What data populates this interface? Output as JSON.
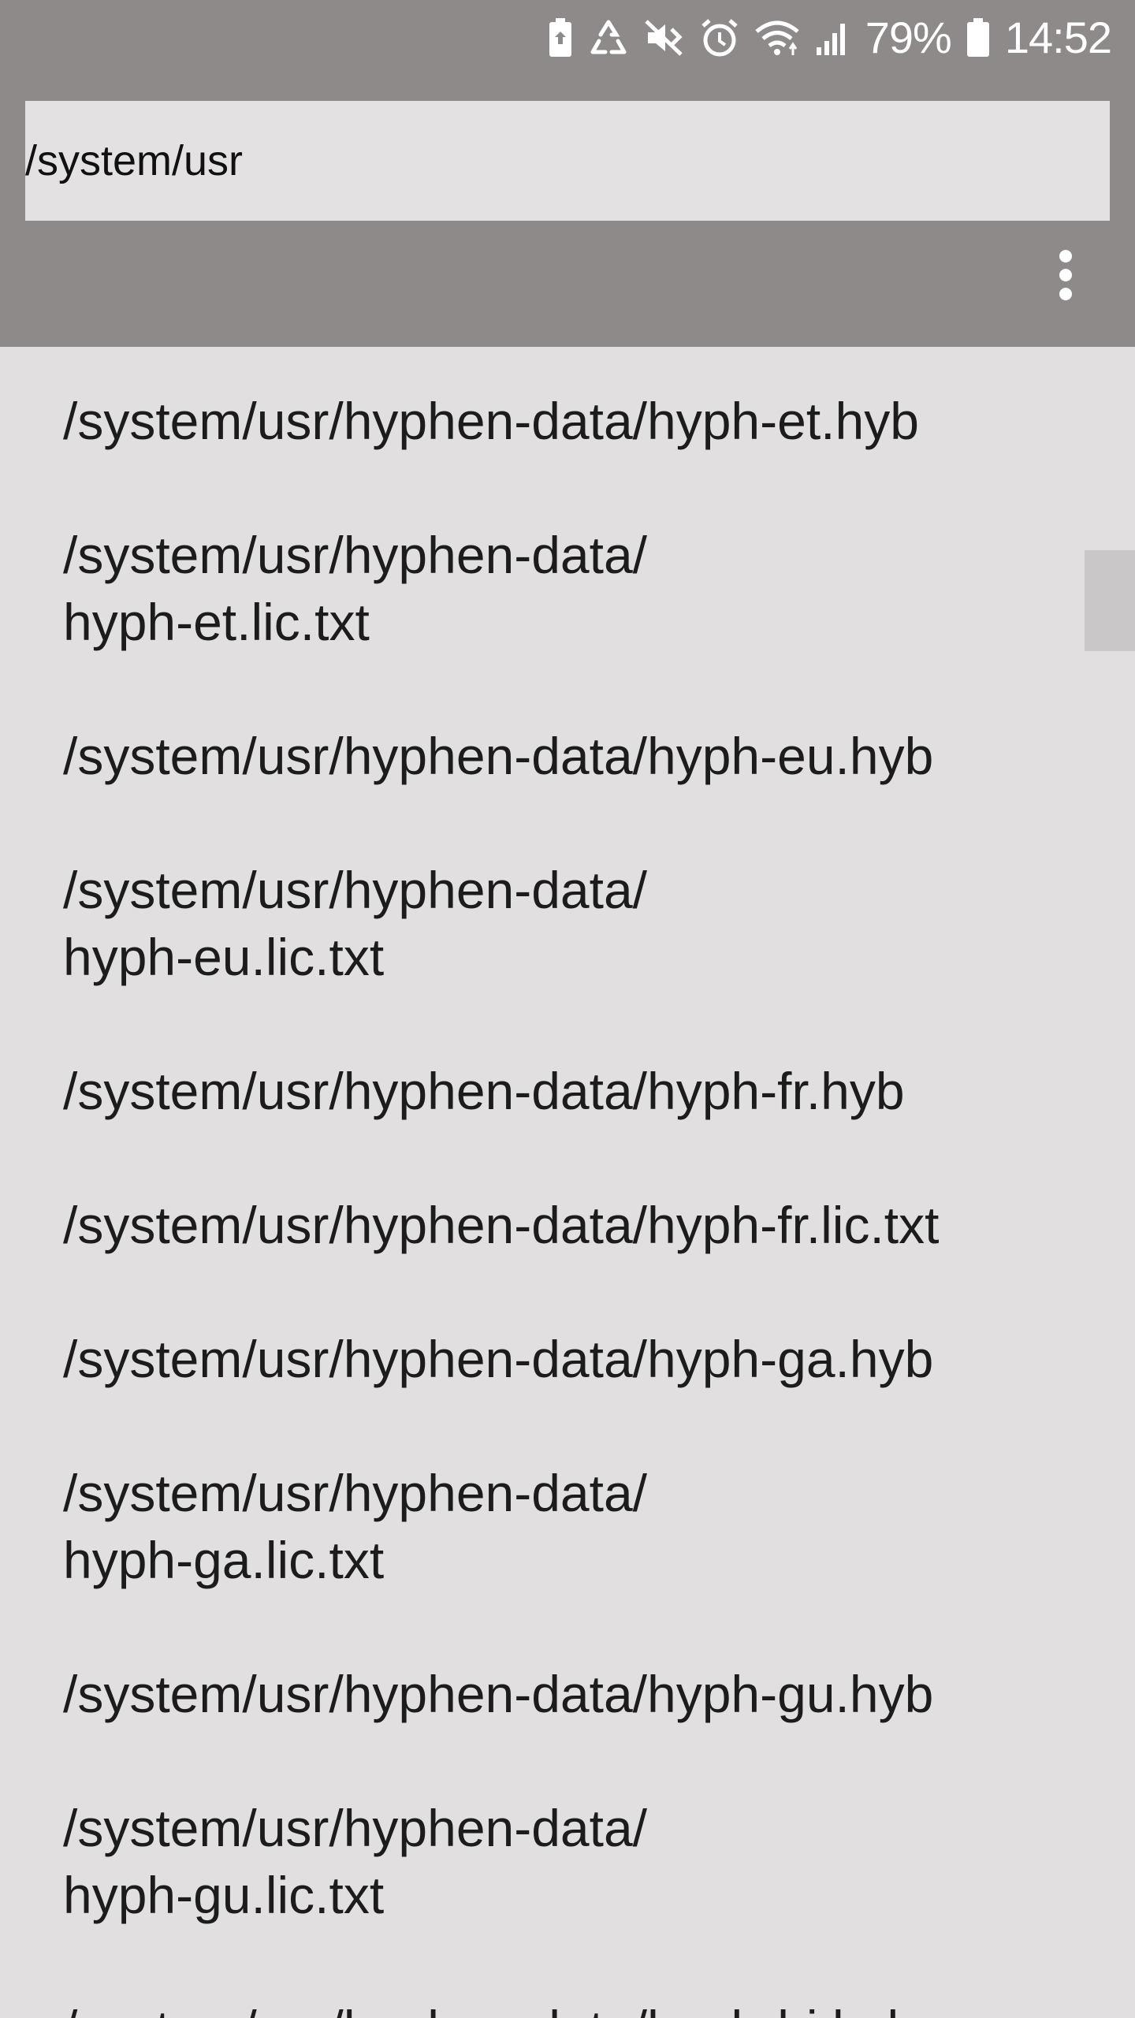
{
  "status_bar": {
    "battery_percent": "79%",
    "time": "14:52",
    "icons": [
      "battery-saver-icon",
      "recycle-icon",
      "mute-vibrate-icon",
      "alarm-icon",
      "wifi-icon",
      "signal-icon",
      "battery-icon"
    ]
  },
  "app_bar": {
    "path_value": "/system/usr",
    "menu_icon": "more-vert-icon"
  },
  "list": {
    "items": [
      "/system/usr/hyphen-data/hyph-et.hyb",
      "/system/usr/hyphen-data/\nhyph-et.lic.txt",
      "/system/usr/hyphen-data/hyph-eu.hyb",
      "/system/usr/hyphen-data/\nhyph-eu.lic.txt",
      "/system/usr/hyphen-data/hyph-fr.hyb",
      "/system/usr/hyphen-data/hyph-fr.lic.txt",
      "/system/usr/hyphen-data/hyph-ga.hyb",
      "/system/usr/hyphen-data/\nhyph-ga.lic.txt",
      "/system/usr/hyphen-data/hyph-gu.hyb",
      "/system/usr/hyphen-data/\nhyph-gu.lic.txt",
      "/system/usr/hyphen-data/hyph-hi.hyb"
    ]
  },
  "colors": {
    "bar": "#8e8a8a",
    "background": "#e1dfdf",
    "input_background": "#e3e1e1",
    "scroll_thumb": "#c9c7c7"
  }
}
